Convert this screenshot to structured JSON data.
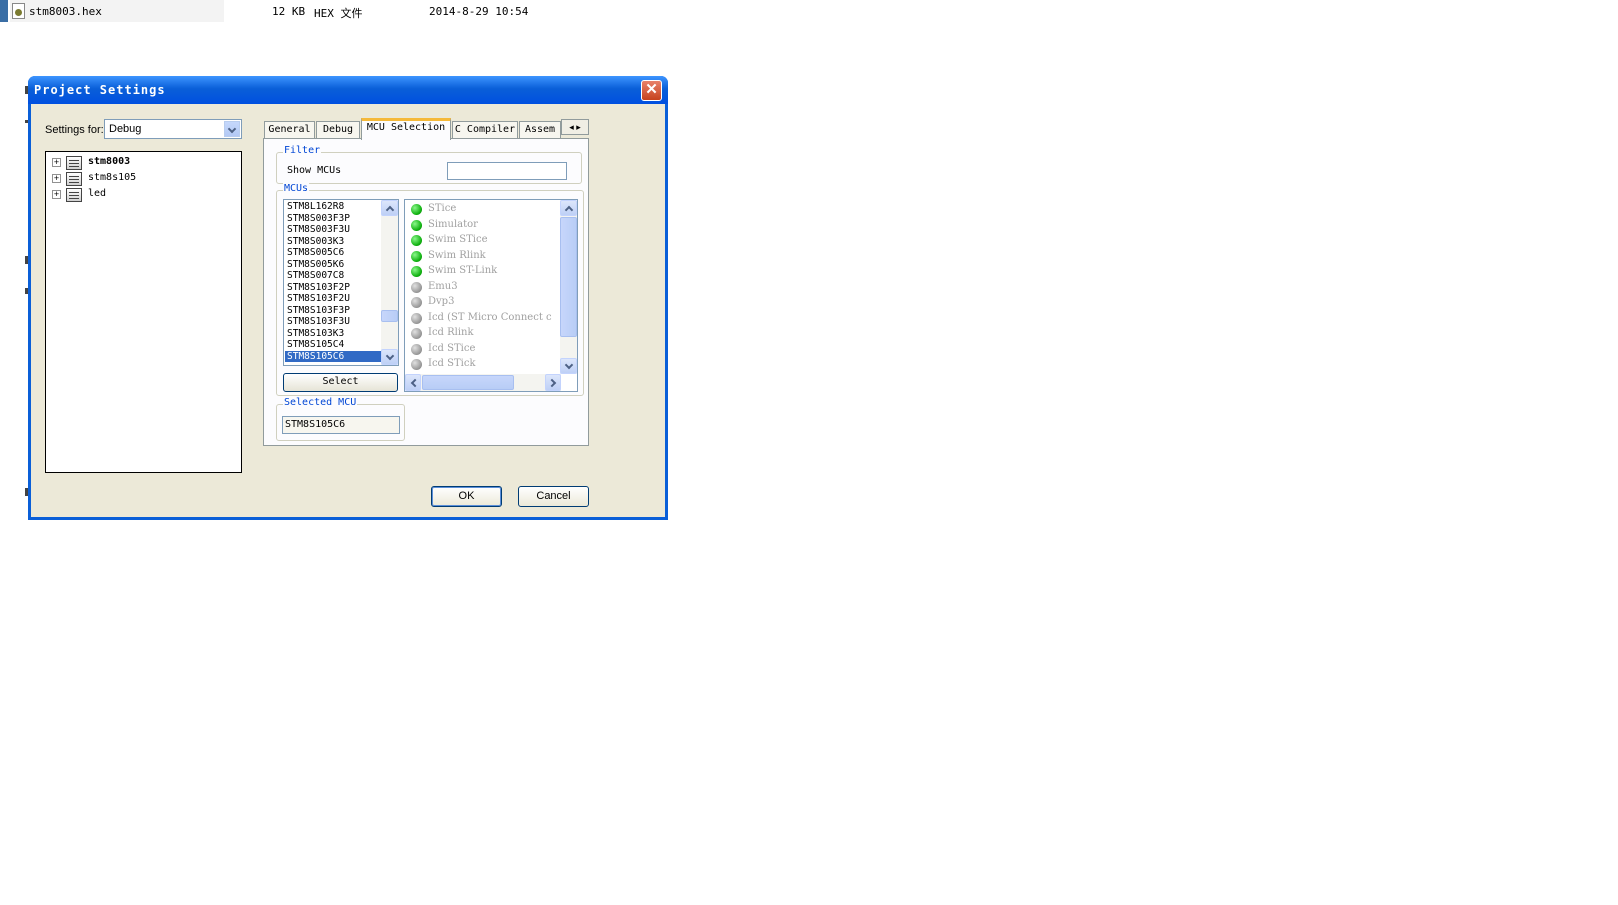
{
  "background": {
    "file_row": {
      "name": "stm8003.hex",
      "size": "12 KB",
      "type": "HEX 文件",
      "modified": "2014-8-29 10:54"
    }
  },
  "dialog": {
    "title": "Project Settings",
    "close_glyph": "✕",
    "settings_for": {
      "label": "Settings for:",
      "value": "Debug"
    },
    "tree": {
      "expander": "+",
      "items": [
        {
          "label": "stm8003",
          "bold": true
        },
        {
          "label": "stm8s105",
          "bold": false
        },
        {
          "label": "led",
          "bold": false
        }
      ]
    },
    "tabs": [
      {
        "label": "General"
      },
      {
        "label": "Debug"
      },
      {
        "label": "MCU Selection"
      },
      {
        "label": "C Compiler"
      },
      {
        "label": "Assem"
      }
    ],
    "tab_scroll_glyph": "◂ ▸",
    "active_tab": "MCU Selection",
    "filter": {
      "title": "Filter",
      "show_label": "Show MCUs",
      "show_value": ""
    },
    "mcus": {
      "title": "MCUs",
      "list": [
        "STM8L162R8",
        "STM8S003F3P",
        "STM8S003F3U",
        "STM8S003K3",
        "STM8S005C6",
        "STM8S005K6",
        "STM8S007C8",
        "STM8S103F2P",
        "STM8S103F2U",
        "STM8S103F3P",
        "STM8S103F3U",
        "STM8S103K3",
        "STM8S105C4",
        "STM8S105C6"
      ],
      "selected": "STM8S105C6",
      "select_button": "Select"
    },
    "debug_tools": [
      {
        "label": "STice",
        "status": "green"
      },
      {
        "label": "Simulator",
        "status": "green"
      },
      {
        "label": "Swim STice",
        "status": "green"
      },
      {
        "label": "Swim Rlink",
        "status": "green"
      },
      {
        "label": "Swim ST-Link",
        "status": "green"
      },
      {
        "label": "Emu3",
        "status": "gray"
      },
      {
        "label": "Dvp3",
        "status": "gray"
      },
      {
        "label": "Icd (ST Micro Connect c",
        "status": "gray"
      },
      {
        "label": "Icd Rlink",
        "status": "gray"
      },
      {
        "label": "Icd STice",
        "status": "gray"
      },
      {
        "label": "Icd STick",
        "status": "gray"
      }
    ],
    "selected_mcu": {
      "title": "Selected MCU",
      "value": "STM8S105C6"
    },
    "buttons": {
      "ok": "OK",
      "cancel": "Cancel"
    },
    "colors": {
      "title_bar": "#0a5fd8",
      "selection": "#316ac5",
      "group_title": "#0046d5",
      "face": "#ece9d8"
    }
  }
}
